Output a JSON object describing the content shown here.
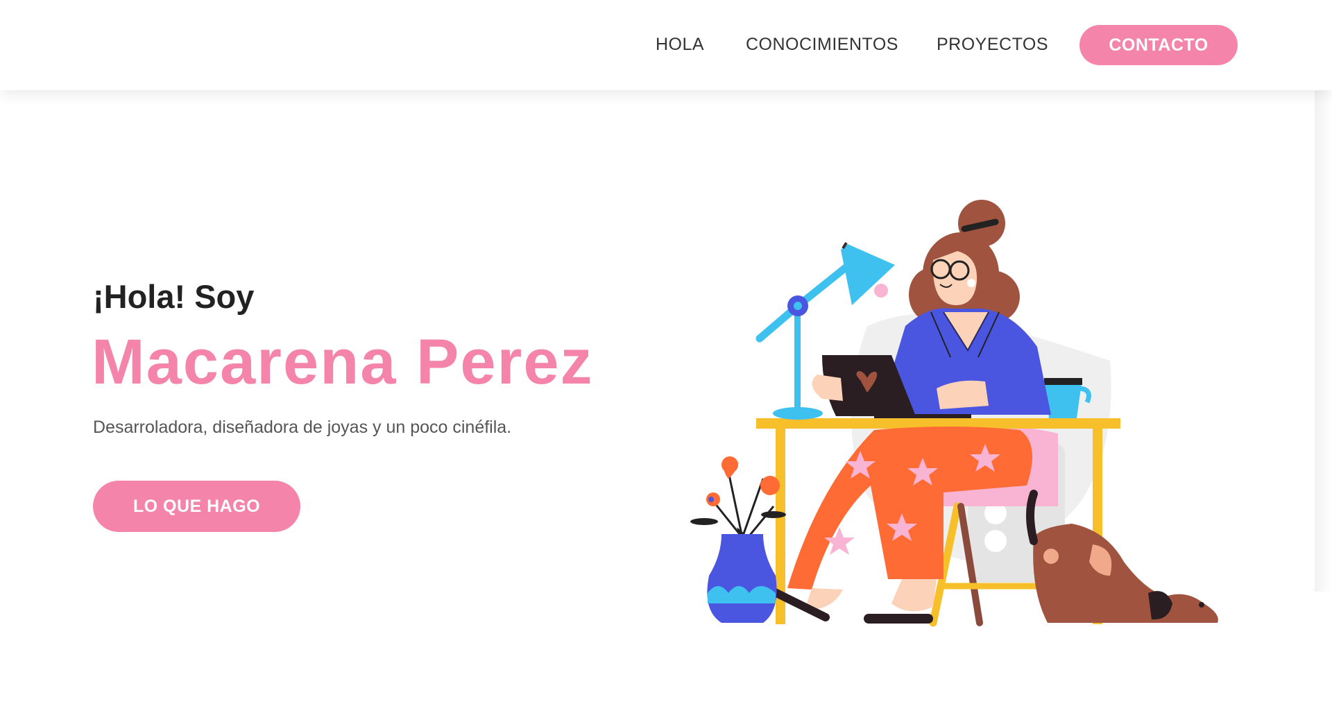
{
  "nav": {
    "items": [
      {
        "label": "HOLA"
      },
      {
        "label": "CONOCIMIENTOS"
      },
      {
        "label": "PROYECTOS"
      }
    ],
    "cta_label": "CONTACTO"
  },
  "hero": {
    "greeting": "¡Hola! Soy",
    "name": "Macarena Perez",
    "description": "Desarroladora, diseñadora de joyas y un poco cinéfila.",
    "cta_label": "LO QUE HAGO"
  },
  "illustration": {
    "subject": "woman-working-at-desk",
    "elements": [
      "desk-lamp-icon",
      "laptop-icon",
      "coffee-mug-icon",
      "flower-vase-icon",
      "dog-icon",
      "chair-icon"
    ]
  },
  "colors": {
    "accent_pink": "#f584ab",
    "text_dark": "#222222",
    "text_body": "#555555",
    "background": "#ffffff"
  }
}
